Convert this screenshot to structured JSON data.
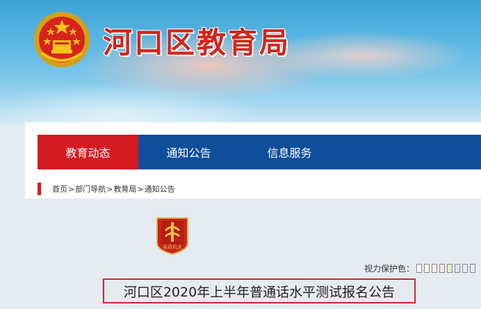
{
  "site": {
    "title": "河口区教育局"
  },
  "nav": {
    "items": [
      {
        "label": "教育动态",
        "active": true
      },
      {
        "label": "通知公告",
        "active": false
      },
      {
        "label": "信息服务",
        "active": false
      }
    ]
  },
  "breadcrumb": {
    "items": [
      "首页",
      "部门导航",
      "教育局",
      "通知公告"
    ],
    "separator": ">"
  },
  "badge": {
    "text": "竞政机关"
  },
  "eye_care": {
    "label": "视力保护色：",
    "swatches": [
      "#ffffff",
      "#faf9de",
      "#fff2e2",
      "#fde6e0",
      "#e3edcd",
      "#dce2f1",
      "#e9ebfe",
      "#eaeaef"
    ]
  },
  "article": {
    "title": "河口区2020年上半年普通话水平测试报名公告"
  },
  "colors": {
    "brand_red": "#d51b22",
    "nav_blue": "#0f4e9a",
    "title_red": "#d2261c"
  }
}
